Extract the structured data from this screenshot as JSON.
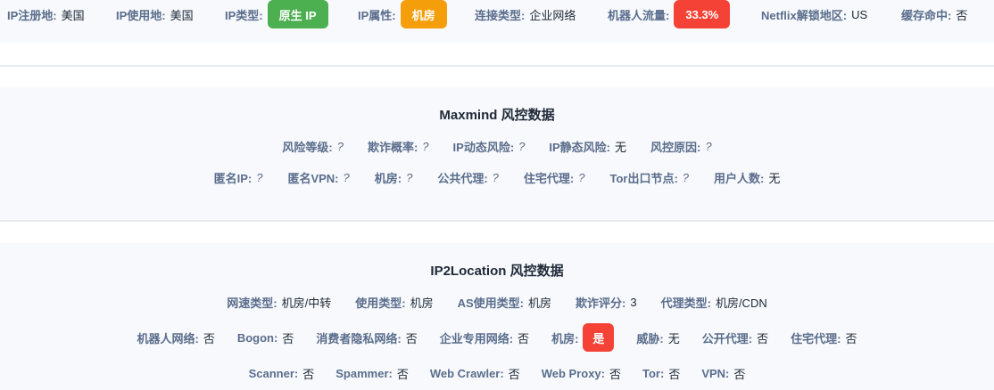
{
  "top": {
    "reg_label": "IP注册地:",
    "reg_value": "美国",
    "use_label": "IP使用地:",
    "use_value": "美国",
    "type_label": "IP类型:",
    "type_badge": "原生 IP",
    "attr_label": "IP属性:",
    "attr_badge": "机房",
    "conn_label": "连接类型:",
    "conn_value": "企业网络",
    "bot_label": "机器人流量:",
    "bot_badge": "33.3%",
    "netflix_label": "Netflix解锁地区:",
    "netflix_value": "US",
    "cache_label": "缓存命中:",
    "cache_value": "否"
  },
  "maxmind": {
    "title": "Maxmind 风控数据",
    "row1": [
      {
        "label": "风险等级:",
        "value": "?"
      },
      {
        "label": "欺诈概率:",
        "value": "?"
      },
      {
        "label": "IP动态风险:",
        "value": "?"
      },
      {
        "label": "IP静态风险:",
        "value": "无"
      },
      {
        "label": "风控原因:",
        "value": "?"
      }
    ],
    "row2": [
      {
        "label": "匿名IP:",
        "value": "?"
      },
      {
        "label": "匿名VPN:",
        "value": "?"
      },
      {
        "label": "机房:",
        "value": "?"
      },
      {
        "label": "公共代理:",
        "value": "?"
      },
      {
        "label": "住宅代理:",
        "value": "?"
      },
      {
        "label": "Tor出口节点:",
        "value": "?"
      },
      {
        "label": "用户人数:",
        "value": "无"
      }
    ]
  },
  "ip2location": {
    "title": "IP2Location 风控数据",
    "row1": [
      {
        "label": "网速类型:",
        "value": "机房/中转"
      },
      {
        "label": "使用类型:",
        "value": "机房"
      },
      {
        "label": "AS使用类型:",
        "value": "机房"
      },
      {
        "label": "欺诈评分:",
        "value": "3"
      },
      {
        "label": "代理类型:",
        "value": "机房/CDN"
      }
    ],
    "row2": {
      "bot_net_label": "机器人网络:",
      "bot_net_value": "否",
      "bogon_label": "Bogon:",
      "bogon_value": "否",
      "privacy_label": "消费者隐私网络:",
      "privacy_value": "否",
      "enterprise_label": "企业专用网络:",
      "enterprise_value": "否",
      "dc_label": "机房:",
      "dc_badge": "是",
      "threat_label": "威胁:",
      "threat_value": "无",
      "public_proxy_label": "公开代理:",
      "public_proxy_value": "否",
      "res_proxy_label": "住宅代理:",
      "res_proxy_value": "否"
    },
    "row3": [
      {
        "label": "Scanner:",
        "value": "否"
      },
      {
        "label": "Spammer:",
        "value": "否"
      },
      {
        "label": "Web Crawler:",
        "value": "否"
      },
      {
        "label": "Web Proxy:",
        "value": "否"
      },
      {
        "label": "Tor:",
        "value": "否"
      },
      {
        "label": "VPN:",
        "value": "否"
      }
    ]
  },
  "colors": {
    "badge_green": "#4caf50",
    "badge_orange": "#f59e0b",
    "badge_red": "#f44336",
    "label": "#5a6d8c"
  }
}
